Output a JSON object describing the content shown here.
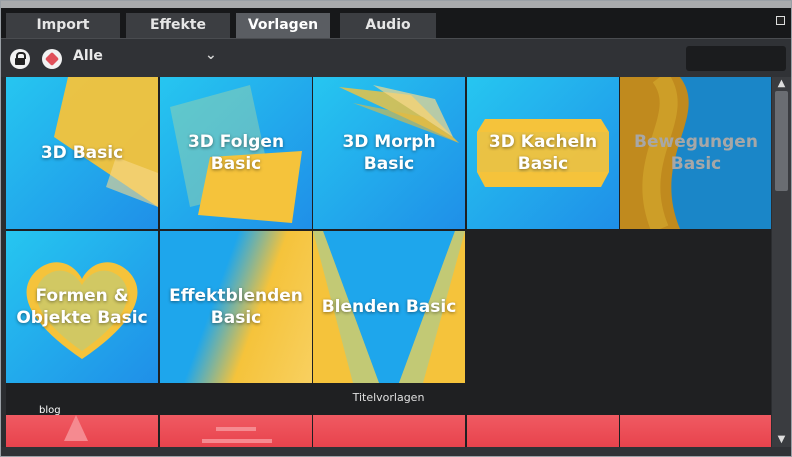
{
  "tabs": [
    {
      "label": "Import",
      "active": false
    },
    {
      "label": "Effekte",
      "active": false
    },
    {
      "label": "Vorlagen",
      "active": true
    },
    {
      "label": "Audio",
      "active": false
    }
  ],
  "toolbar": {
    "lock_icon": "lock-icon",
    "tag_icon": "tag-icon",
    "filter_value": "Alle",
    "search_value": ""
  },
  "templates": [
    {
      "label": "3D Basic"
    },
    {
      "label": "3D Folgen Basic"
    },
    {
      "label": "3D Morph Basic"
    },
    {
      "label": "3D Kacheln Basic"
    },
    {
      "label": "Bewegungen Basic"
    },
    {
      "label": "Formen & Objekte Basic"
    },
    {
      "label": "Effektblenden Basic"
    },
    {
      "label": "Blenden Basic"
    }
  ],
  "section": {
    "title": "Titelvorlagen",
    "first_item": "blog"
  },
  "colors": {
    "tile_blue": "#1f9bea",
    "tile_yellow": "#f5c33b",
    "title_red": "#e8434d"
  }
}
